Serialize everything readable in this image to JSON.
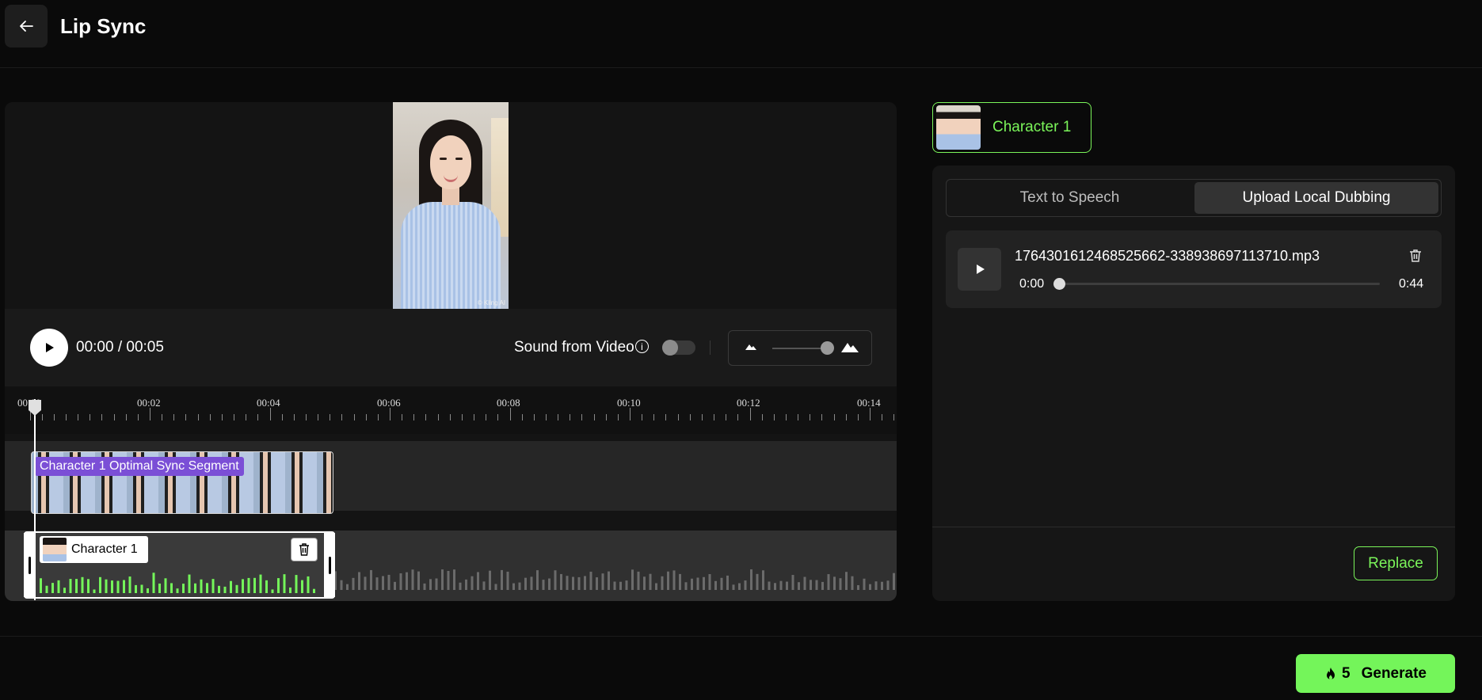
{
  "header": {
    "title": "Lip Sync"
  },
  "player": {
    "time": "00:00 / 00:05",
    "sound_label": "Sound from Video",
    "sound_enabled": false,
    "video_watermark": "© Kling AI"
  },
  "timeline": {
    "ruler_labels": [
      "00:00",
      "00:02",
      "00:04",
      "00:06",
      "00:08",
      "00:10",
      "00:12",
      "00:14"
    ],
    "video_clip_label": "Character 1 Optimal Sync Segment",
    "audio_clip_label": "Character 1"
  },
  "character": {
    "name": "Character 1"
  },
  "tabs": {
    "tts": "Text to Speech",
    "upload": "Upload Local Dubbing",
    "active": "upload"
  },
  "audio": {
    "file_name": "1764301612468525662-338938697113710.mp3",
    "current": "0:00",
    "duration": "0:44",
    "progress": 0
  },
  "actions": {
    "replace": "Replace",
    "generate_cost": "5",
    "generate": "Generate"
  },
  "colors": {
    "accent": "#74f55a",
    "clip_badge": "#7b4fd6"
  }
}
